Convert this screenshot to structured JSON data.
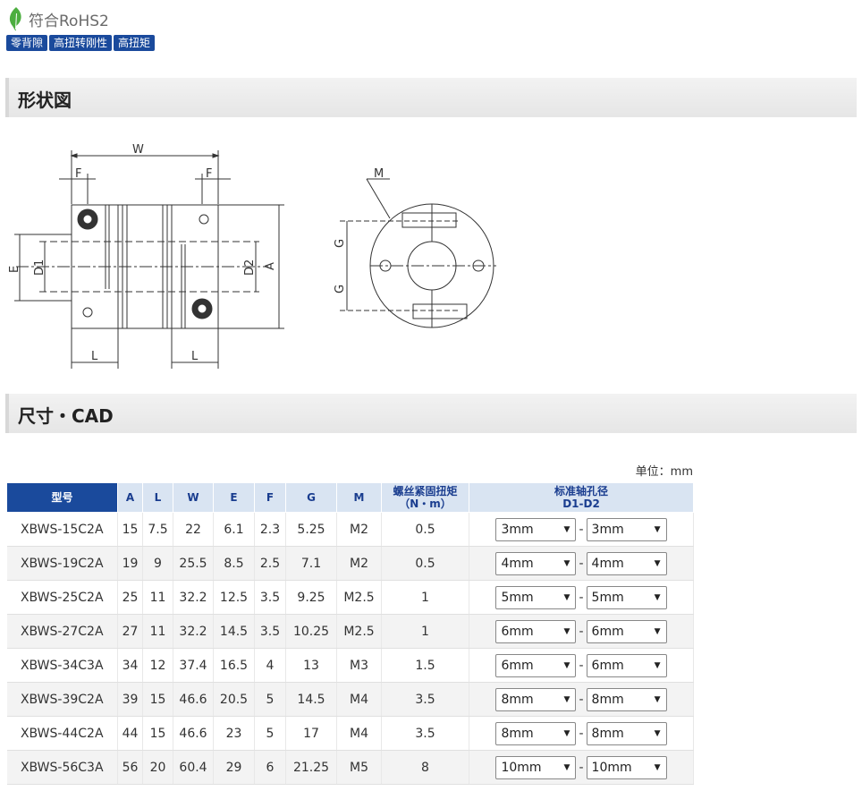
{
  "rohs": {
    "label": "符合RoHS2"
  },
  "tags": [
    "零背隙",
    "高扭转刚性",
    "高扭矩"
  ],
  "sections": {
    "shape_title": "形状図",
    "dimension_title": "尺寸・CAD"
  },
  "diagram_labels": {
    "W": "W",
    "F_left": "F",
    "F_right": "F",
    "E": "E",
    "D1": "D1",
    "D2": "D2",
    "A": "A",
    "L_left": "L",
    "L_right": "L",
    "M": "M",
    "G_top": "G",
    "G_bottom": "G"
  },
  "unit_note": "单位：mm",
  "table": {
    "headers": {
      "model": "型号",
      "A": "A",
      "L": "L",
      "W": "W",
      "E": "E",
      "F": "F",
      "G": "G",
      "M": "M",
      "torque_line1": "螺丝紧固扭矩",
      "torque_line2": "（N・m）",
      "bore_line1": "标准轴孔径",
      "bore_line2": "D1-D2"
    },
    "rows": [
      {
        "model": "XBWS-15C2A",
        "A": "15",
        "L": "7.5",
        "W": "22",
        "E": "6.1",
        "F": "2.3",
        "G": "5.25",
        "M": "M2",
        "torque": "0.5",
        "d1": "3mm",
        "d2": "3mm"
      },
      {
        "model": "XBWS-19C2A",
        "A": "19",
        "L": "9",
        "W": "25.5",
        "E": "8.5",
        "F": "2.5",
        "G": "7.1",
        "M": "M2",
        "torque": "0.5",
        "d1": "4mm",
        "d2": "4mm"
      },
      {
        "model": "XBWS-25C2A",
        "A": "25",
        "L": "11",
        "W": "32.2",
        "E": "12.5",
        "F": "3.5",
        "G": "9.25",
        "M": "M2.5",
        "torque": "1",
        "d1": "5mm",
        "d2": "5mm"
      },
      {
        "model": "XBWS-27C2A",
        "A": "27",
        "L": "11",
        "W": "32.2",
        "E": "14.5",
        "F": "3.5",
        "G": "10.25",
        "M": "M2.5",
        "torque": "1",
        "d1": "6mm",
        "d2": "6mm"
      },
      {
        "model": "XBWS-34C3A",
        "A": "34",
        "L": "12",
        "W": "37.4",
        "E": "16.5",
        "F": "4",
        "G": "13",
        "M": "M3",
        "torque": "1.5",
        "d1": "6mm",
        "d2": "6mm"
      },
      {
        "model": "XBWS-39C2A",
        "A": "39",
        "L": "15",
        "W": "46.6",
        "E": "20.5",
        "F": "5",
        "G": "14.5",
        "M": "M4",
        "torque": "3.5",
        "d1": "8mm",
        "d2": "8mm"
      },
      {
        "model": "XBWS-44C2A",
        "A": "44",
        "L": "15",
        "W": "46.6",
        "E": "23",
        "F": "5",
        "G": "17",
        "M": "M4",
        "torque": "3.5",
        "d1": "8mm",
        "d2": "8mm"
      },
      {
        "model": "XBWS-56C3A",
        "A": "56",
        "L": "20",
        "W": "60.4",
        "E": "29",
        "F": "6",
        "G": "21.25",
        "M": "M5",
        "torque": "8",
        "d1": "10mm",
        "d2": "10mm"
      }
    ]
  }
}
